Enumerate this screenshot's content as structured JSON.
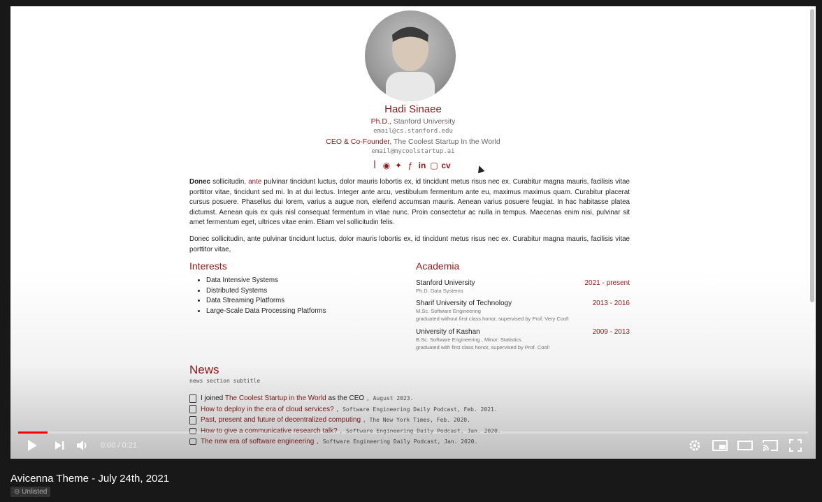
{
  "profile": {
    "name": "Hadi Sinaee",
    "degree": "Ph.D.,",
    "degree_org": "Stanford University",
    "email1": "email@cs.stanford.edu",
    "role": "CEO & Co-Founder,",
    "role_org": "The Coolest Startup In the World",
    "email2": "email@mycoolstartup.ai",
    "social_icons": [
      "google-scholar-icon",
      "github-icon",
      "twitter-icon",
      "facebook-icon",
      "linkedin-icon",
      "twitch-icon"
    ],
    "cv_label": "cv"
  },
  "bio": {
    "p1_bold": "Donec",
    "p1_a": " sollicitudin, ",
    "p1_link": "ante",
    "p1_b": " pulvinar tincidunt luctus, dolor mauris lobortis ex, id tincidunt metus risus nec ex. Curabitur magna mauris, facilisis vitae porttitor vitae, tincidunt sed mi. In at dui lectus. Integer ante arcu, vestibulum fermentum ante eu, maximus maximus quam. Curabitur placerat cursus posuere. Phasellus dui lorem, varius a augue non, eleifend accumsan mauris. Aenean varius posuere feugiat. In hac habitasse platea dictumst. Aenean quis ex quis nisl consequat fermentum in vitae nunc. Proin consectetur ac nulla in tempus. Maecenas enim nisi, pulvinar sit amet fermentum eget, ultrices vitae enim. Etiam vel sollicitudin felis.",
    "p2": "Donec sollicitudin, ante pulvinar tincidunt luctus, dolor mauris lobortis ex, id tincidunt metus risus nec ex. Curabitur magna mauris, facilisis vitae porttitor vitae,"
  },
  "interests": {
    "title": "Interests",
    "items": [
      "Data Intensive Systems",
      "Distributed Systems",
      "Data Streaming Platforms",
      "Large-Scale Data Processing Platforms"
    ]
  },
  "academia": {
    "title": "Academia",
    "entries": [
      {
        "school": "Stanford University",
        "years": "2021 - present",
        "detail1": "Ph.D. Data Systems",
        "detail2": ""
      },
      {
        "school": "Sharif University of Technology",
        "years": "2013 - 2016",
        "detail1": "M.Sc. Software Engineering",
        "detail2": "graduated without first class honor, supervised by Prof. Very Cool!"
      },
      {
        "school": "University of Kashan",
        "years": "2009 - 2013",
        "detail1": "B.Sc. Software Engineering , Minor: Statistics",
        "detail2": "graduated with first class honor, supervised by Prof. Cool!"
      }
    ]
  },
  "news": {
    "title": "News",
    "subtitle": "news section subtitle",
    "items": [
      {
        "pre": "I joined ",
        "link": "The Coolest Startup in the World",
        "post": " as the CEO",
        "source": ", August 2023.",
        "icon": "document-icon"
      },
      {
        "pre": "",
        "link": "How to deploy in the era of cloud services?",
        "post": "",
        "source": ", Software Engineering Daily Podcast, Feb. 2021.",
        "icon": "document-icon"
      },
      {
        "pre": "",
        "link": "Past, present and future of decentralized computing",
        "post": "",
        "source": ", The New York Times, Feb. 2020.",
        "icon": "document-icon"
      },
      {
        "pre": "",
        "link": "How to give a communicative research talk?",
        "post": "",
        "source": ", Software Engineering Daily Podcast, Jan. 2020.",
        "icon": "video-icon"
      },
      {
        "pre": "",
        "link": "The new era of software engineering",
        "post": "",
        "source": ", Software Engineering Daily Podcast, Jan. 2020.",
        "icon": "video-icon"
      }
    ]
  },
  "player": {
    "time": "0:00 / 0:21",
    "progress": 0.037,
    "play_icon": "play-icon",
    "next_icon": "next-icon",
    "volume_icon": "volume-icon",
    "settings_icon": "gear-icon",
    "miniplayer_icon": "miniplayer-icon",
    "theater_icon": "theater-icon",
    "cast_icon": "cast-icon",
    "fullscreen_icon": "fullscreen-icon",
    "accent_color": "#ff0000"
  },
  "video": {
    "title": "Avicenna Theme - July 24th, 2021",
    "visibility": "Unlisted"
  },
  "colors": {
    "page_accent": "#8b1c1c",
    "page_background": "#181818"
  }
}
